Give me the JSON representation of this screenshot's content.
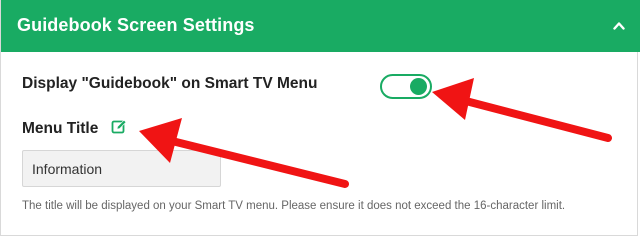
{
  "header": {
    "title": "Guidebook Screen Settings",
    "collapse_icon": "chevron-up-icon",
    "color": "#19ab63"
  },
  "display_setting": {
    "label": "Display \"Guidebook\" on Smart TV Menu",
    "toggle_on": true
  },
  "menu_title": {
    "label": "Menu Title",
    "edit_icon": "edit-icon",
    "value": "Information",
    "hint": "The title will be displayed on your Smart TV menu. Please ensure it does not exceed the 16-character limit."
  },
  "annotations": {
    "arrow_color": "#f01414"
  }
}
